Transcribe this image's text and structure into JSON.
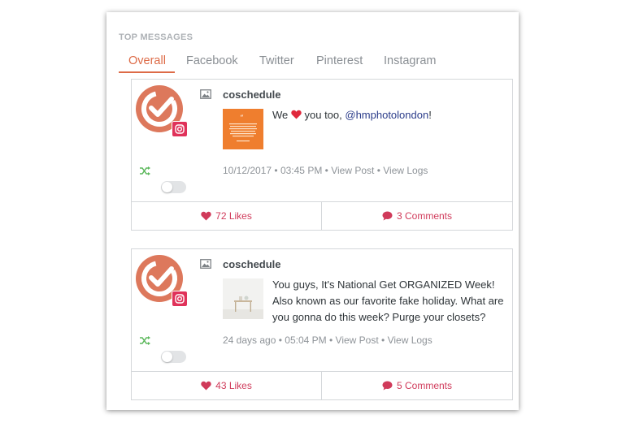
{
  "section_title": "TOP MESSAGES",
  "tabs": [
    {
      "label": "Overall",
      "active": true
    },
    {
      "label": "Facebook",
      "active": false
    },
    {
      "label": "Twitter",
      "active": false
    },
    {
      "label": "Pinterest",
      "active": false
    },
    {
      "label": "Instagram",
      "active": false
    }
  ],
  "colors": {
    "accent": "#dd6b47",
    "avatar": "#dd785c",
    "instagram": "#e0325a",
    "likes": "#d03a5a",
    "shuffle": "#5cb85c",
    "heart_emoji": "#e0283c"
  },
  "messages": [
    {
      "username": "coschedule",
      "text_before": "We",
      "text_emoji": "heart",
      "text_middle": " you too, ",
      "mention": "@hmphotolondon",
      "text_after": "!",
      "timestamp": "10/12/2017",
      "time": "03:45 PM",
      "view_post": "View Post",
      "view_logs": "View Logs",
      "separator": "•",
      "likes": "72 Likes",
      "comments": "3 Comments",
      "toggle_on": false
    },
    {
      "username": "coschedule",
      "text": "You guys, It's National Get ORGANIZED Week! Also known as our favorite fake holiday. What are you gonna do this week? Purge your closets?",
      "timestamp": "24 days ago",
      "time": "05:04 PM",
      "view_post": "View Post",
      "view_logs": "View Logs",
      "separator": "•",
      "likes": "43 Likes",
      "comments": "5 Comments",
      "toggle_on": false
    }
  ]
}
